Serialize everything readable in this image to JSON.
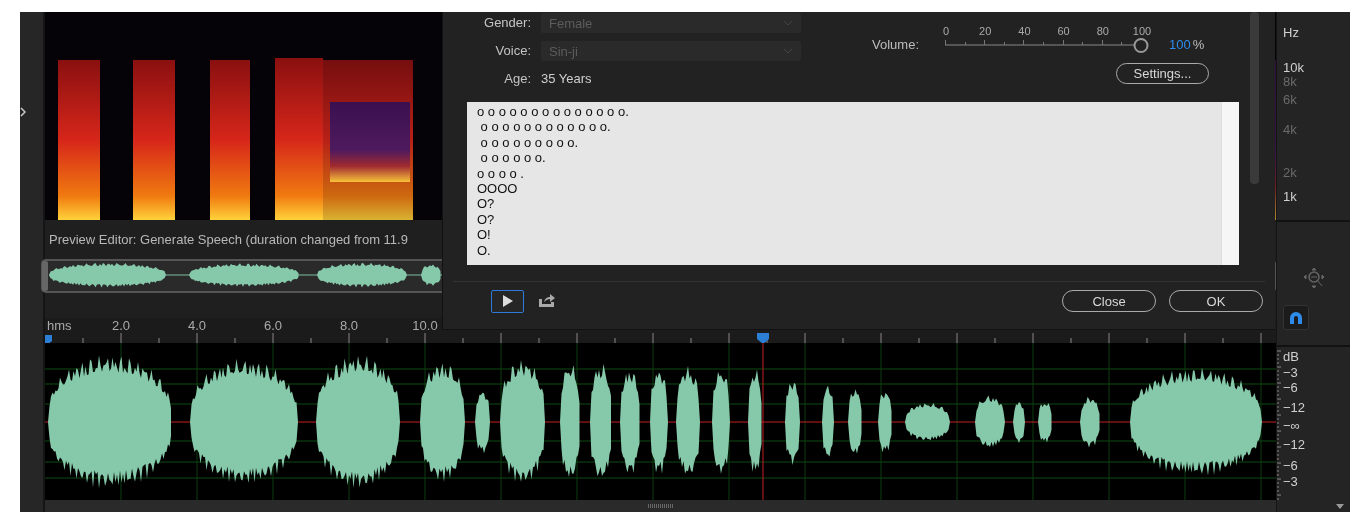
{
  "preview_caption": "Preview Editor: Generate Speech (duration changed from 11.9",
  "timeline": {
    "labels": [
      "hms",
      "2.0",
      "4.0",
      "6.0",
      "8.0",
      "10.0"
    ]
  },
  "frequency_scale": {
    "unit": "Hz",
    "labels": [
      {
        "text": "10k",
        "major": true
      },
      {
        "text": "8k",
        "major": false
      },
      {
        "text": "6k",
        "major": false
      },
      {
        "text": "4k",
        "major": false
      },
      {
        "text": "2k",
        "major": false
      },
      {
        "text": "1k",
        "major": true
      }
    ]
  },
  "snap_button": {
    "on": true
  },
  "db_scale": {
    "unit": "dB",
    "labels": [
      "−3",
      "−6",
      "−12",
      "−∞",
      "−12",
      "−6",
      "−3"
    ]
  },
  "dialog": {
    "fields": [
      {
        "label": "Gender:",
        "value": "Female",
        "kind": "dropdown",
        "disabled": true
      },
      {
        "label": "Voice:",
        "value": "Sin-ji",
        "kind": "dropdown",
        "disabled": true
      },
      {
        "label": "Age:",
        "value": "35 Years",
        "kind": "text"
      }
    ],
    "volume": {
      "label": "Volume:",
      "ticks": [
        "0",
        "20",
        "40",
        "60",
        "80",
        "100"
      ],
      "level": 1,
      "reading": "100",
      "unit": "%"
    },
    "settings_button": "Settings...",
    "text_lines": [
      "o o o o o o o o o o o o o o.",
      " o o o o o o o o o o o o.",
      " o o o o o o o o o.",
      " o o o o o o.",
      "o o o o .",
      "OOOO",
      "O?",
      "O?",
      "O!",
      "O."
    ],
    "play_button": {
      "selected": true
    },
    "buttons": [
      "Close",
      "OK"
    ]
  }
}
